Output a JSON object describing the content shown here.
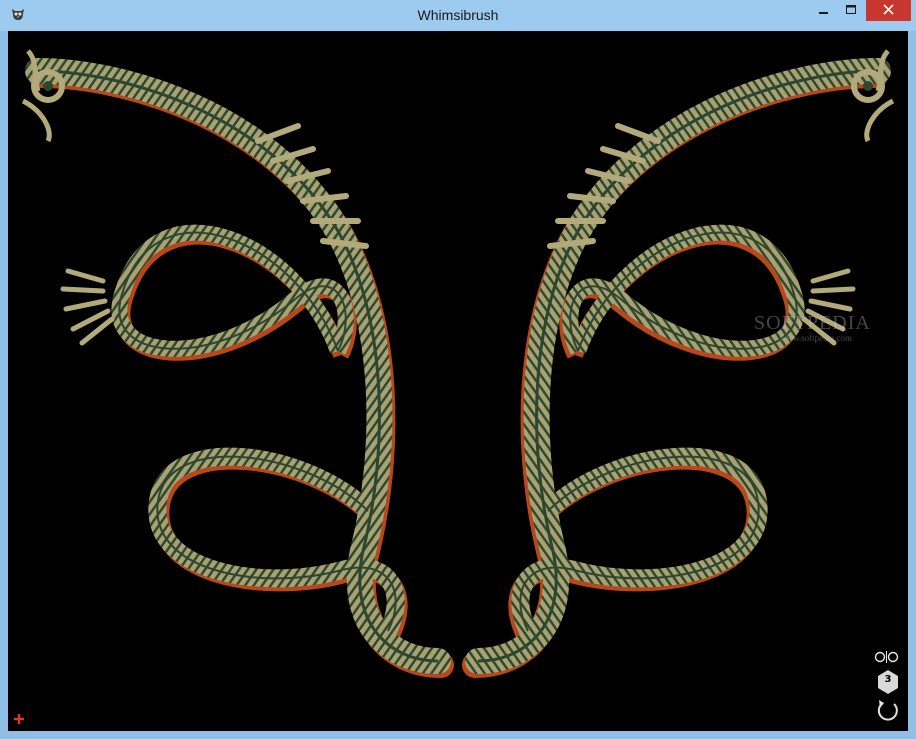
{
  "window": {
    "title": "Whimsibrush",
    "icons": {
      "app": "owl-icon",
      "minimize": "minimize-icon",
      "maximize": "maximize-icon",
      "close": "close-icon"
    },
    "colors": {
      "titlebar": "#9ccbef",
      "frame": "#8fbfe6",
      "close": "#c7372f"
    }
  },
  "canvas": {
    "background": "#000000",
    "stroke_colors": {
      "ribbon": "#b3aa7c",
      "accent": "#3e5e3e",
      "shadow": "#b8481c"
    }
  },
  "watermark": {
    "brand": "SOFTPEDIA",
    "url": "www.softpedia.com"
  },
  "tools": {
    "add_icon": "plus-icon",
    "mirror_icon": "mirror-circles-icon",
    "symmetry_count": "3",
    "undo_icon": "undo-arrow-icon",
    "add_color": "#d93a1a"
  }
}
